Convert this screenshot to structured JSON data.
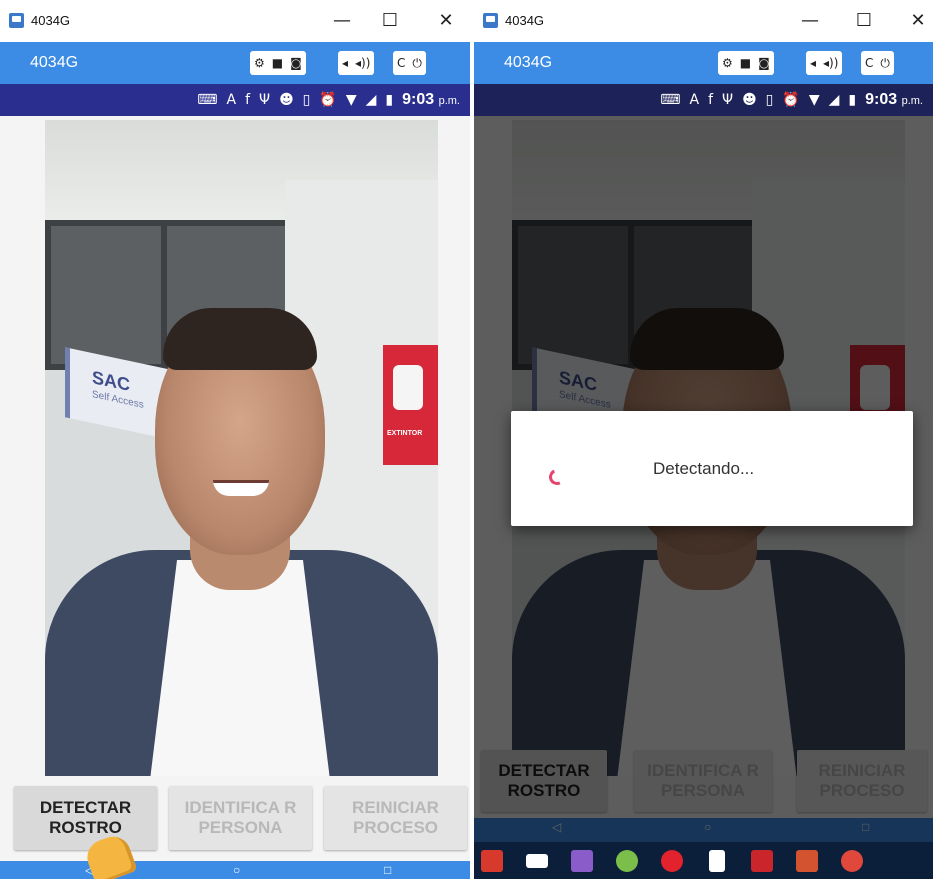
{
  "window_title": "4034G",
  "window_controls": {
    "minimize": "—",
    "maximize": "☐",
    "close": "✕"
  },
  "emulator": {
    "device_name": "4034G",
    "tools": [
      "⚙",
      "■",
      "◙",
      "◂",
      "◂))",
      "C",
      "⏻"
    ]
  },
  "status_bar": {
    "icons": [
      "⌨",
      "A",
      "f",
      "Ψ",
      "☻",
      "▯",
      "⏰",
      "▼",
      "◢",
      "▮"
    ],
    "time": "9:03",
    "ampm": "p.m."
  },
  "photo_sign": {
    "sac_title": "SAC",
    "sac_sub": "Self Access",
    "ext": "EXTINTOR"
  },
  "buttons": {
    "detect": "DETECTAR ROSTRO",
    "identify": "IDENTIFICA R PERSONA",
    "reset": "REINICIAR PROCESO"
  },
  "dialog": {
    "message": "Detectando..."
  },
  "nav": {
    "back": "◁",
    "home": "○",
    "recent": "□"
  },
  "taskbar_apps": [
    "wps-icon",
    "mail-icon",
    "visual-studio-icon",
    "android-studio-icon",
    "opera-icon",
    "file-icon",
    "acrobat-icon",
    "powerpoint-icon",
    "chrome-icon"
  ]
}
